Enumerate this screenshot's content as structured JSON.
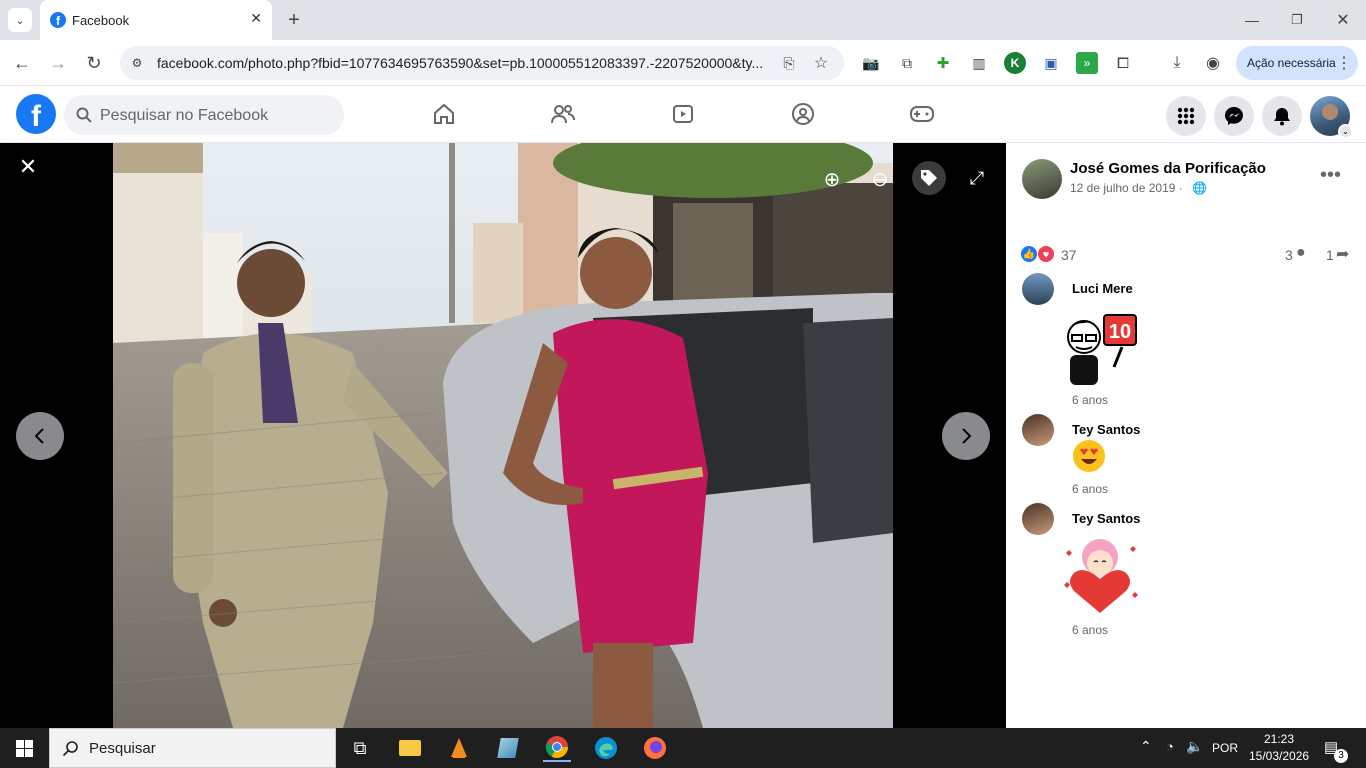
{
  "browser": {
    "tab_title": "Facebook",
    "url": "facebook.com/photo.php?fbid=1077634695763590&set=pb.100005512083397.-2207520000&ty...",
    "acao_label": "Ação necessária"
  },
  "fb": {
    "search_placeholder": "Pesquisar no Facebook",
    "nav_icons": [
      "home-icon",
      "friends-icon",
      "watch-icon",
      "groups-icon",
      "gaming-icon"
    ]
  },
  "post": {
    "author": "José Gomes da Porificação",
    "date": "12 de julho de 2019 ·",
    "reactions_count": "37",
    "comments_count": "3",
    "shares_count": "1"
  },
  "comments": [
    {
      "name": "Luci Mere",
      "sticker": "10",
      "time": "6 anos"
    },
    {
      "name": "Tey Santos",
      "sticker": "heart-eyes-emoji",
      "time": "6 anos"
    },
    {
      "name": "Tey Santos",
      "sticker": "heart-girl-sticker",
      "time": "6 anos"
    }
  ],
  "taskbar": {
    "search_label": "Pesquisar",
    "lang": "POR",
    "time": "21:23",
    "date": "15/03/2026",
    "notif_count": "3"
  },
  "colors": {
    "fb_blue": "#1877f2",
    "viewer_bg": "#000000",
    "taskbar": "#1f1f1f"
  }
}
